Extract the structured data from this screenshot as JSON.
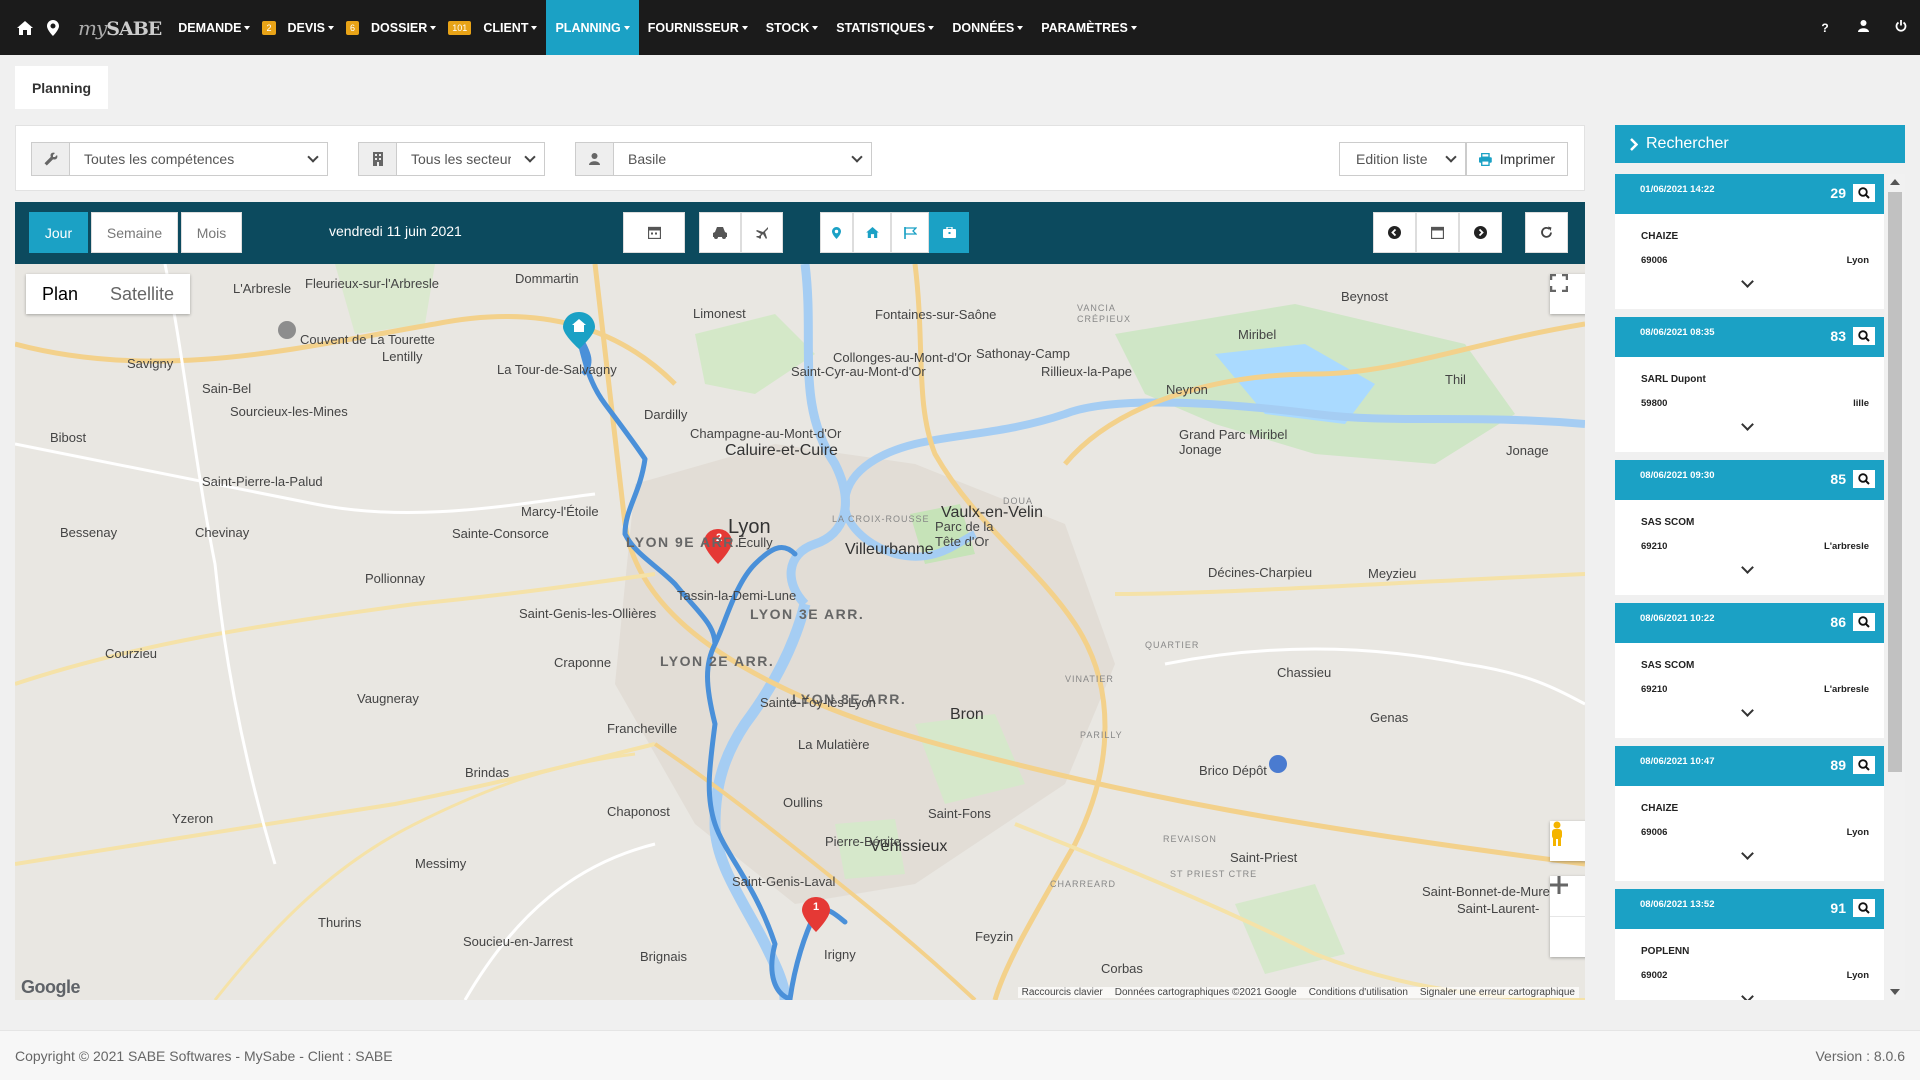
{
  "brand": {
    "prefix": "my",
    "name": "SABE"
  },
  "nav": [
    {
      "label": "DEMANDE",
      "badge": "2"
    },
    {
      "label": "DEVIS",
      "badge": "6"
    },
    {
      "label": "DOSSIER",
      "badge": "101"
    },
    {
      "label": "CLIENT",
      "badge": ""
    },
    {
      "label": "PLANNING",
      "badge": "",
      "active": true
    },
    {
      "label": "FOURNISSEUR",
      "badge": ""
    },
    {
      "label": "STOCK",
      "badge": ""
    },
    {
      "label": "STATISTIQUES",
      "badge": ""
    },
    {
      "label": "DONNÉES",
      "badge": ""
    },
    {
      "label": "PARAMÈTRES",
      "badge": ""
    }
  ],
  "top_right": {
    "help": "?"
  },
  "page_tab": "Planning",
  "filters": {
    "competences": "Toutes les compétences",
    "secteurs": "Tous les secteurs",
    "technicien": "Basile",
    "edition": "Edition liste",
    "print": "Imprimer"
  },
  "view_tabs": {
    "day": "Jour",
    "week": "Semaine",
    "month": "Mois"
  },
  "current_date": "vendredi 11 juin 2021",
  "map": {
    "type_plan": "Plan",
    "type_satellite": "Satellite",
    "markers": [
      "1",
      "2"
    ],
    "labels": {
      "lyon": "Lyon",
      "lyon9": "LYON 9E ARR.",
      "lyon3": "LYON 3E ARR.",
      "lyon2": "LYON 2E ARR.",
      "lyon8": "LYON 8E ARR.",
      "villeurbanne": "Villeurbanne",
      "caluire": "Caluire-et-Cuire",
      "vaulx": "Vaulx-en-Velin",
      "venissieux": "Vénissieux",
      "bron": "Bron",
      "limonest": "Limonest",
      "dardilly": "Dardilly",
      "champagne": "Champagne-au-Mont-d'Or",
      "ecully": "Écully",
      "tassin": "Tassin-la-Demi-Lune",
      "craponne": "Craponne",
      "francheville": "Francheville",
      "oullins": "Oullins",
      "pierre_benite": "Pierre-Bénite",
      "saint_fons": "Saint-Fons",
      "feyzin": "Feyzin",
      "corbas": "Corbas",
      "saint_priest": "Saint-Priest",
      "chassieu": "Chassieu",
      "decines": "Décines-Charpieu",
      "meyzieu": "Meyzieu",
      "genas": "Genas",
      "fontaines": "Fontaines-sur-Saône",
      "collonges": "Collonges-au-Mont-d'Or",
      "sathonay": "Sathonay-Camp",
      "rillieux": "Rillieux-la-Pape",
      "neyron": "Neyron",
      "miribel": "Miribel",
      "grand_parc": "Grand Parc Miribel Jonage",
      "jonage": "Jonage",
      "beynost": "Beynost",
      "thil": "Thil",
      "tour_salvagny": "La Tour-de-Salvagny",
      "saint_cyr": "Saint-Cyr-au-Mont-d'Or",
      "marcy": "Marcy-l'Étoile",
      "sainte_consorce": "Sainte-Consorce",
      "saint_genis_ollieres": "Saint-Genis-les-Ollières",
      "sainte_foy": "Sainte-Foy-lès-Lyon",
      "la_mulatiere": "La Mulatière",
      "saint_genis_laval": "Saint-Genis-Laval",
      "irigny": "Irigny",
      "brignais": "Brignais",
      "chaponost": "Chaponost",
      "brindas": "Brindas",
      "messimy": "Messimy",
      "vaugneray": "Vaugneray",
      "pollionnay": "Pollionnay",
      "courzieu": "Courzieu",
      "yzeron": "Yzeron",
      "thurins": "Thurins",
      "soucieu": "Soucieu-en-Jarrest",
      "sain_bel": "Sain-Bel",
      "savigny": "Savigny",
      "sourcieux": "Sourcieux-les-Mines",
      "bibost": "Bibost",
      "bessenay": "Bessenay",
      "chevinay": "Chevinay",
      "saint_pierre_palud": "Saint-Pierre-la-Palud",
      "arbresle": "L'Arbresle",
      "fleurieux": "Fleurieux-sur-l'Arbresle",
      "dommartin": "Dommartin",
      "lentilly": "Lentilly",
      "couvent": "Couvent de La Tourette",
      "parc_tete_or": "Parc de la Tête d'Or",
      "brico": "Brico Dépôt",
      "saint_bonnet": "Saint-Bonnet-de-Mure",
      "saint_laurent": "Saint-Laurent-",
      "la_croix_rousse": "LA CROIX-ROUSSE",
      "doua": "DOUA",
      "quartier": "QUARTIER",
      "vinatier": "VINATIER",
      "parilly": "PARILLY",
      "revaison": "REVAISON",
      "st_priest_ctre": "ST PRIEST CTRE",
      "charreard": "CHARREARD",
      "vancia": "VANCIA",
      "crepieux": "CRÉPIEUX"
    },
    "attribution": [
      "Raccourcis clavier",
      "Données cartographiques ©2021 Google",
      "Conditions d'utilisation",
      "Signaler une erreur cartographique"
    ],
    "google": "Google"
  },
  "search_panel": {
    "title": "Rechercher"
  },
  "cards": [
    {
      "datetime": "01/06/2021 14:22",
      "number": "29",
      "name": "CHAIZE",
      "postcode": "69006",
      "city": "Lyon"
    },
    {
      "datetime": "08/06/2021 08:35",
      "number": "83",
      "name": "SARL Dupont",
      "postcode": "59800",
      "city": "lille"
    },
    {
      "datetime": "08/06/2021 09:30",
      "number": "85",
      "name": "SAS SCOM",
      "postcode": "69210",
      "city": "L'arbresle"
    },
    {
      "datetime": "08/06/2021 10:22",
      "number": "86",
      "name": "SAS SCOM",
      "postcode": "69210",
      "city": "L'arbresle"
    },
    {
      "datetime": "08/06/2021 10:47",
      "number": "89",
      "name": "CHAIZE",
      "postcode": "69006",
      "city": "Lyon"
    },
    {
      "datetime": "08/06/2021 13:52",
      "number": "91",
      "name": "POPLENN",
      "postcode": "69002",
      "city": "Lyon"
    }
  ],
  "footer": {
    "copyright": "Copyright © 2021 SABE Softwares - MySabe - Client : SABE",
    "version": "Version : 8.0.6"
  },
  "colors": {
    "accent": "#1ba1c5",
    "dark": "#1b1b1b",
    "panel": "#0c4a5e",
    "route": "#4a90d9",
    "marker": "#e53935"
  }
}
